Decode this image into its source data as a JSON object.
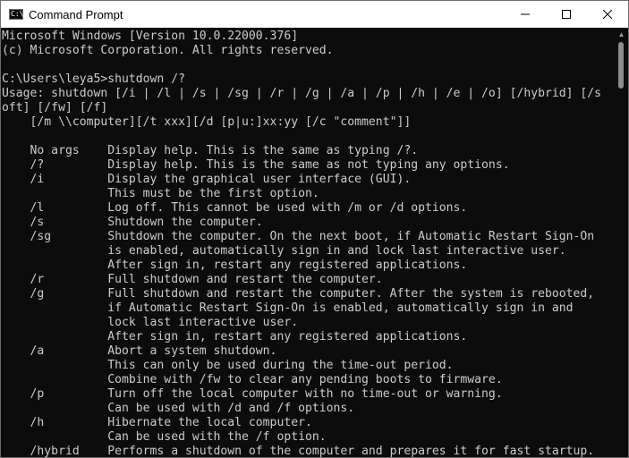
{
  "window": {
    "title": "Command Prompt",
    "icon_text": "C:\\",
    "buttons": {
      "minimize_icon": "minimize-icon",
      "maximize_icon": "maximize-icon",
      "close_icon": "close-icon"
    }
  },
  "terminal": {
    "lines": [
      "Microsoft Windows [Version 10.0.22000.376]",
      "(c) Microsoft Corporation. All rights reserved.",
      "",
      "C:\\Users\\leya5>shutdown /?",
      "Usage: shutdown [/i | /l | /s | /sg | /r | /g | /a | /p | /h | /e | /o] [/hybrid] [/s",
      "oft] [/fw] [/f]",
      "    [/m \\\\computer][/t xxx][/d [p|u:]xx:yy [/c \"comment\"]]",
      "",
      "    No args    Display help. This is the same as typing /?.",
      "    /?         Display help. This is the same as not typing any options.",
      "    /i         Display the graphical user interface (GUI).",
      "               This must be the first option.",
      "    /l         Log off. This cannot be used with /m or /d options.",
      "    /s         Shutdown the computer.",
      "    /sg        Shutdown the computer. On the next boot, if Automatic Restart Sign-On",
      "               is enabled, automatically sign in and lock last interactive user.",
      "               After sign in, restart any registered applications.",
      "    /r         Full shutdown and restart the computer.",
      "    /g         Full shutdown and restart the computer. After the system is rebooted,",
      "               if Automatic Restart Sign-On is enabled, automatically sign in and",
      "               lock last interactive user.",
      "               After sign in, restart any registered applications.",
      "    /a         Abort a system shutdown.",
      "               This can only be used during the time-out period.",
      "               Combine with /fw to clear any pending boots to firmware.",
      "    /p         Turn off the local computer with no time-out or warning.",
      "               Can be used with /d and /f options.",
      "    /h         Hibernate the local computer.",
      "               Can be used with the /f option.",
      "    /hybrid    Performs a shutdown of the computer and prepares it for fast startup."
    ]
  },
  "colors": {
    "terminal_bg": "#0c0c0c",
    "terminal_fg": "#cccccc",
    "titlebar_bg": "#ffffff"
  }
}
